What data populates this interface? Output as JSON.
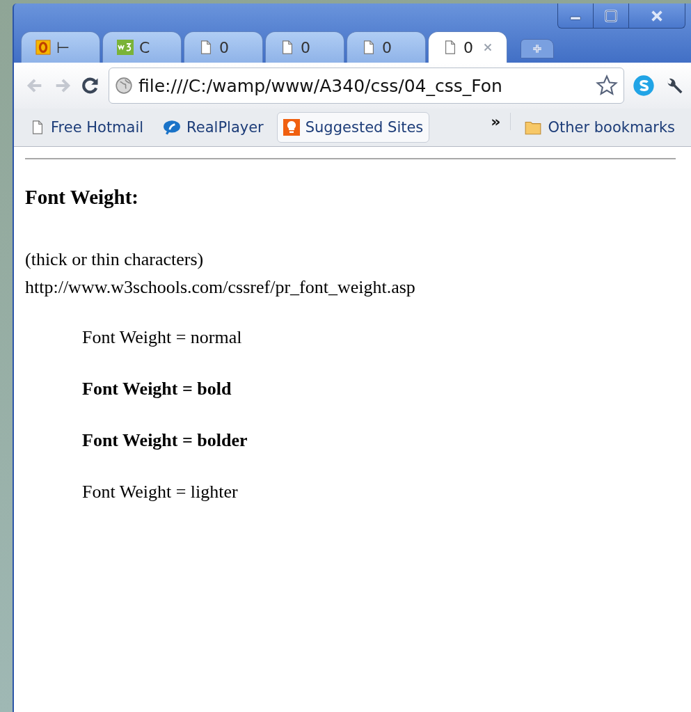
{
  "tabs": [
    {
      "kind": "outlook",
      "title": "⊢",
      "selected": false
    },
    {
      "kind": "w3",
      "title": "C",
      "selected": false
    },
    {
      "kind": "page",
      "title": "0",
      "selected": false
    },
    {
      "kind": "page",
      "title": "0",
      "selected": false
    },
    {
      "kind": "page",
      "title": "0",
      "selected": false
    },
    {
      "kind": "page",
      "title": "0",
      "selected": true
    }
  ],
  "address": {
    "value": "file:///C:/wamp/www/A340/css/04_css_Fon"
  },
  "bookmarks": [
    {
      "kind": "page",
      "label": "Free Hotmail",
      "selected": false
    },
    {
      "kind": "realplayer",
      "label": "RealPlayer",
      "selected": false
    },
    {
      "kind": "bulb",
      "label": "Suggested Sites",
      "selected": true
    }
  ],
  "overflow": "»",
  "other_bookmarks": "Other bookmarks",
  "page": {
    "heading": "Font Weight:",
    "intro": [
      "(thick or thin characters)",
      "http://www.w3schools.com/cssref/pr_font_weight.asp"
    ],
    "samples": [
      {
        "kind": "normal",
        "text": "Font Weight = normal"
      },
      {
        "kind": "bold",
        "text": "Font Weight = bold"
      },
      {
        "kind": "bolder",
        "text": "Font Weight = bolder"
      },
      {
        "kind": "lighter",
        "text": "Font Weight = lighter"
      }
    ]
  }
}
